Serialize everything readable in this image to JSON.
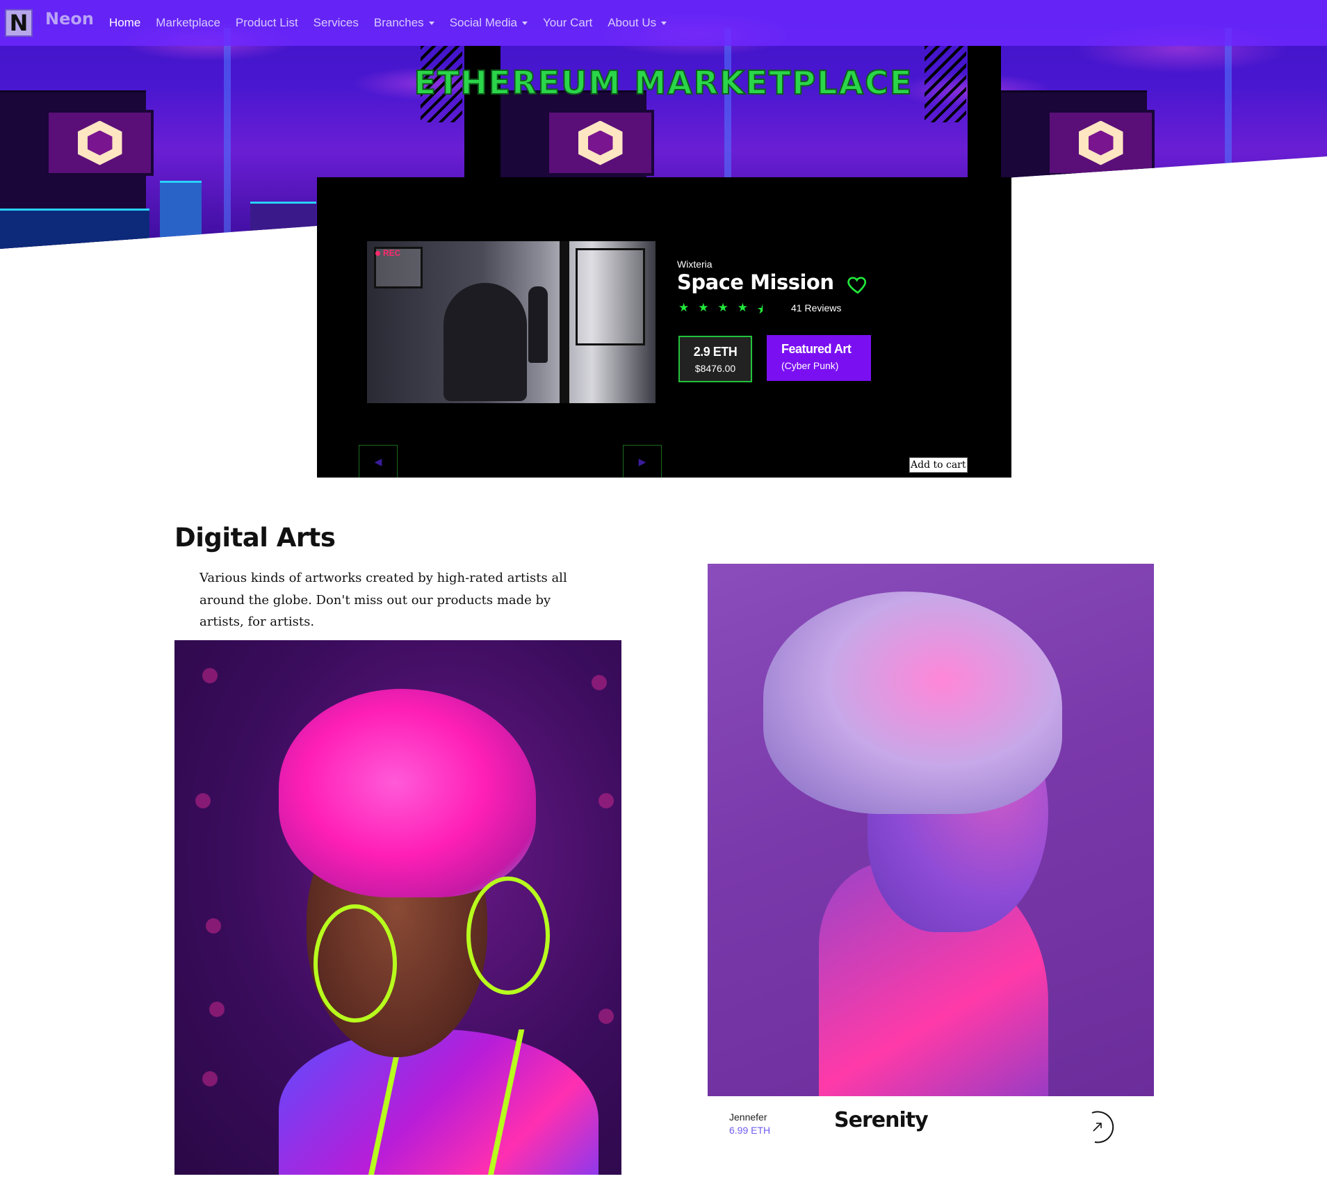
{
  "nav": {
    "logo_letter": "N",
    "brand": "Neon",
    "items": [
      {
        "label": "Home",
        "active": true,
        "dropdown": false
      },
      {
        "label": "Marketplace",
        "active": false,
        "dropdown": false
      },
      {
        "label": "Product List",
        "active": false,
        "dropdown": false
      },
      {
        "label": "Services",
        "active": false,
        "dropdown": false
      },
      {
        "label": "Branches",
        "active": false,
        "dropdown": true
      },
      {
        "label": "Social Media",
        "active": false,
        "dropdown": true
      },
      {
        "label": "Your Cart",
        "active": false,
        "dropdown": false
      },
      {
        "label": "About Us",
        "active": false,
        "dropdown": true
      }
    ]
  },
  "hero": {
    "title": "ETHEREUM MARKETPLACE"
  },
  "featured": {
    "image_tag": "REC",
    "artist": "Wixteria",
    "title": "Space Mission",
    "rating": 4.5,
    "reviews": "41 Reviews",
    "price_eth": "2.9 ETH",
    "price_usd": "$8476.00",
    "badge_title": "Featured Art",
    "badge_subtitle": "(Cyber Punk)",
    "add_to_cart": "Add to cart",
    "accent_color": "#22e83b",
    "badge_color": "#7a10f2"
  },
  "digital_arts": {
    "title": "Digital Arts",
    "description": "Various kinds of artworks created by  high-rated artists all around the globe. Don't miss out our products made by artists, for artists.",
    "cards": [
      {
        "artist": "Jennefer",
        "price": "6.99 ETH",
        "title": "Serenity"
      }
    ]
  },
  "colors": {
    "navbar": "#6e28ff",
    "price_link": "#6d5cf0"
  }
}
